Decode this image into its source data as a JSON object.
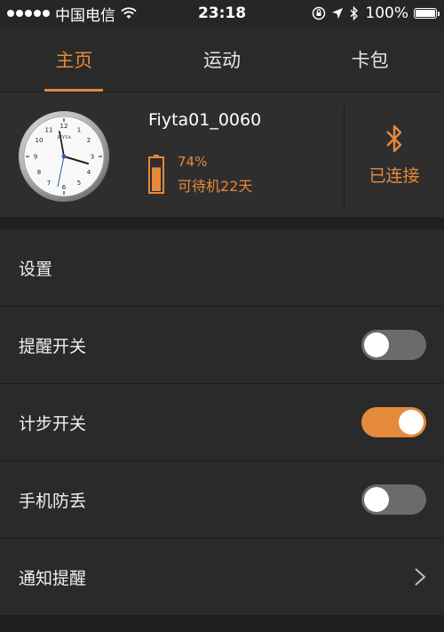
{
  "status_bar": {
    "carrier": "中国电信",
    "time": "23:18",
    "battery": "100%",
    "icons": [
      "wifi-icon",
      "rotation-lock-icon",
      "location-arrow-icon",
      "bluetooth-icon",
      "battery-icon"
    ]
  },
  "tabs": [
    {
      "label": "主页",
      "active": true
    },
    {
      "label": "运动",
      "active": false
    },
    {
      "label": "卡包",
      "active": false
    }
  ],
  "device": {
    "name": "Fiyta01_0060",
    "watch_brand": "FIYTA",
    "battery_percent_label": "74%",
    "battery_level": 0.74,
    "standby": "可待机22天",
    "connection_status": "已连接"
  },
  "settings": {
    "header": "设置",
    "rows": [
      {
        "label": "提醒开关",
        "type": "toggle",
        "on": false
      },
      {
        "label": "计步开关",
        "type": "toggle",
        "on": true
      },
      {
        "label": "手机防丢",
        "type": "toggle",
        "on": false
      },
      {
        "label": "通知提醒",
        "type": "link"
      }
    ]
  },
  "colors": {
    "accent": "#e5893b",
    "background": "#232323",
    "panel": "#2e2e2e",
    "toggle_off": "#6b6b6b"
  }
}
